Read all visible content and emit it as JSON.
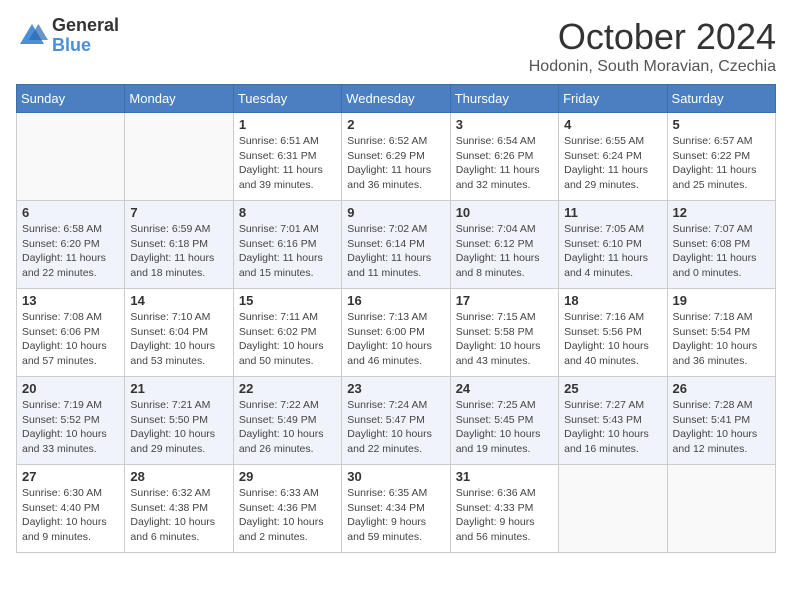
{
  "logo": {
    "general": "General",
    "blue": "Blue"
  },
  "title": {
    "month": "October 2024",
    "location": "Hodonin, South Moravian, Czechia"
  },
  "days_of_week": [
    "Sunday",
    "Monday",
    "Tuesday",
    "Wednesday",
    "Thursday",
    "Friday",
    "Saturday"
  ],
  "weeks": [
    [
      {
        "day": "",
        "info": ""
      },
      {
        "day": "",
        "info": ""
      },
      {
        "day": "1",
        "info": "Sunrise: 6:51 AM\nSunset: 6:31 PM\nDaylight: 11 hours and 39 minutes."
      },
      {
        "day": "2",
        "info": "Sunrise: 6:52 AM\nSunset: 6:29 PM\nDaylight: 11 hours and 36 minutes."
      },
      {
        "day": "3",
        "info": "Sunrise: 6:54 AM\nSunset: 6:26 PM\nDaylight: 11 hours and 32 minutes."
      },
      {
        "day": "4",
        "info": "Sunrise: 6:55 AM\nSunset: 6:24 PM\nDaylight: 11 hours and 29 minutes."
      },
      {
        "day": "5",
        "info": "Sunrise: 6:57 AM\nSunset: 6:22 PM\nDaylight: 11 hours and 25 minutes."
      }
    ],
    [
      {
        "day": "6",
        "info": "Sunrise: 6:58 AM\nSunset: 6:20 PM\nDaylight: 11 hours and 22 minutes."
      },
      {
        "day": "7",
        "info": "Sunrise: 6:59 AM\nSunset: 6:18 PM\nDaylight: 11 hours and 18 minutes."
      },
      {
        "day": "8",
        "info": "Sunrise: 7:01 AM\nSunset: 6:16 PM\nDaylight: 11 hours and 15 minutes."
      },
      {
        "day": "9",
        "info": "Sunrise: 7:02 AM\nSunset: 6:14 PM\nDaylight: 11 hours and 11 minutes."
      },
      {
        "day": "10",
        "info": "Sunrise: 7:04 AM\nSunset: 6:12 PM\nDaylight: 11 hours and 8 minutes."
      },
      {
        "day": "11",
        "info": "Sunrise: 7:05 AM\nSunset: 6:10 PM\nDaylight: 11 hours and 4 minutes."
      },
      {
        "day": "12",
        "info": "Sunrise: 7:07 AM\nSunset: 6:08 PM\nDaylight: 11 hours and 0 minutes."
      }
    ],
    [
      {
        "day": "13",
        "info": "Sunrise: 7:08 AM\nSunset: 6:06 PM\nDaylight: 10 hours and 57 minutes."
      },
      {
        "day": "14",
        "info": "Sunrise: 7:10 AM\nSunset: 6:04 PM\nDaylight: 10 hours and 53 minutes."
      },
      {
        "day": "15",
        "info": "Sunrise: 7:11 AM\nSunset: 6:02 PM\nDaylight: 10 hours and 50 minutes."
      },
      {
        "day": "16",
        "info": "Sunrise: 7:13 AM\nSunset: 6:00 PM\nDaylight: 10 hours and 46 minutes."
      },
      {
        "day": "17",
        "info": "Sunrise: 7:15 AM\nSunset: 5:58 PM\nDaylight: 10 hours and 43 minutes."
      },
      {
        "day": "18",
        "info": "Sunrise: 7:16 AM\nSunset: 5:56 PM\nDaylight: 10 hours and 40 minutes."
      },
      {
        "day": "19",
        "info": "Sunrise: 7:18 AM\nSunset: 5:54 PM\nDaylight: 10 hours and 36 minutes."
      }
    ],
    [
      {
        "day": "20",
        "info": "Sunrise: 7:19 AM\nSunset: 5:52 PM\nDaylight: 10 hours and 33 minutes."
      },
      {
        "day": "21",
        "info": "Sunrise: 7:21 AM\nSunset: 5:50 PM\nDaylight: 10 hours and 29 minutes."
      },
      {
        "day": "22",
        "info": "Sunrise: 7:22 AM\nSunset: 5:49 PM\nDaylight: 10 hours and 26 minutes."
      },
      {
        "day": "23",
        "info": "Sunrise: 7:24 AM\nSunset: 5:47 PM\nDaylight: 10 hours and 22 minutes."
      },
      {
        "day": "24",
        "info": "Sunrise: 7:25 AM\nSunset: 5:45 PM\nDaylight: 10 hours and 19 minutes."
      },
      {
        "day": "25",
        "info": "Sunrise: 7:27 AM\nSunset: 5:43 PM\nDaylight: 10 hours and 16 minutes."
      },
      {
        "day": "26",
        "info": "Sunrise: 7:28 AM\nSunset: 5:41 PM\nDaylight: 10 hours and 12 minutes."
      }
    ],
    [
      {
        "day": "27",
        "info": "Sunrise: 6:30 AM\nSunset: 4:40 PM\nDaylight: 10 hours and 9 minutes."
      },
      {
        "day": "28",
        "info": "Sunrise: 6:32 AM\nSunset: 4:38 PM\nDaylight: 10 hours and 6 minutes."
      },
      {
        "day": "29",
        "info": "Sunrise: 6:33 AM\nSunset: 4:36 PM\nDaylight: 10 hours and 2 minutes."
      },
      {
        "day": "30",
        "info": "Sunrise: 6:35 AM\nSunset: 4:34 PM\nDaylight: 9 hours and 59 minutes."
      },
      {
        "day": "31",
        "info": "Sunrise: 6:36 AM\nSunset: 4:33 PM\nDaylight: 9 hours and 56 minutes."
      },
      {
        "day": "",
        "info": ""
      },
      {
        "day": "",
        "info": ""
      }
    ]
  ]
}
